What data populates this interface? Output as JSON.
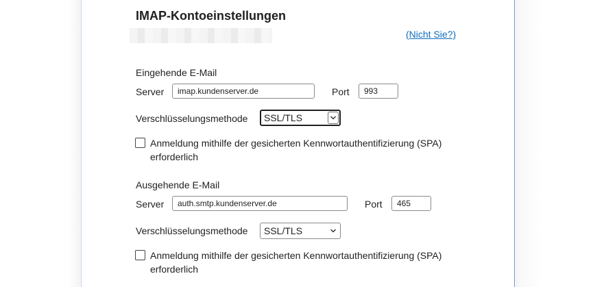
{
  "dialog": {
    "title": "IMAP-Kontoeinstellungen",
    "not_you_link": "(Nicht Sie?)"
  },
  "incoming": {
    "section_label": "Eingehende E-Mail",
    "server_label": "Server",
    "server_value": "imap.kundenserver.de",
    "port_label": "Port",
    "port_value": "993",
    "encryption_label": "Verschlüsselungsmethode",
    "encryption_value": "SSL/TLS",
    "spa_label": "Anmeldung mithilfe der gesicherten Kennwortauthentifizierung (SPA) erforderlich",
    "spa_checked": false
  },
  "outgoing": {
    "section_label": "Ausgehende E-Mail",
    "server_label": "Server",
    "server_value": "auth.smtp.kundenserver.de",
    "port_label": "Port",
    "port_value": "465",
    "encryption_label": "Verschlüsselungsmethode",
    "encryption_value": "SSL/TLS",
    "spa_label": "Anmeldung mithilfe der gesicherten Kennwortauthentifizierung (SPA) erforderlich",
    "spa_checked": false
  },
  "icons": {
    "dropdown": "chevron-down-icon"
  },
  "colors": {
    "link": "#0f6cbd",
    "dialog_border": "#6e9ed6"
  }
}
